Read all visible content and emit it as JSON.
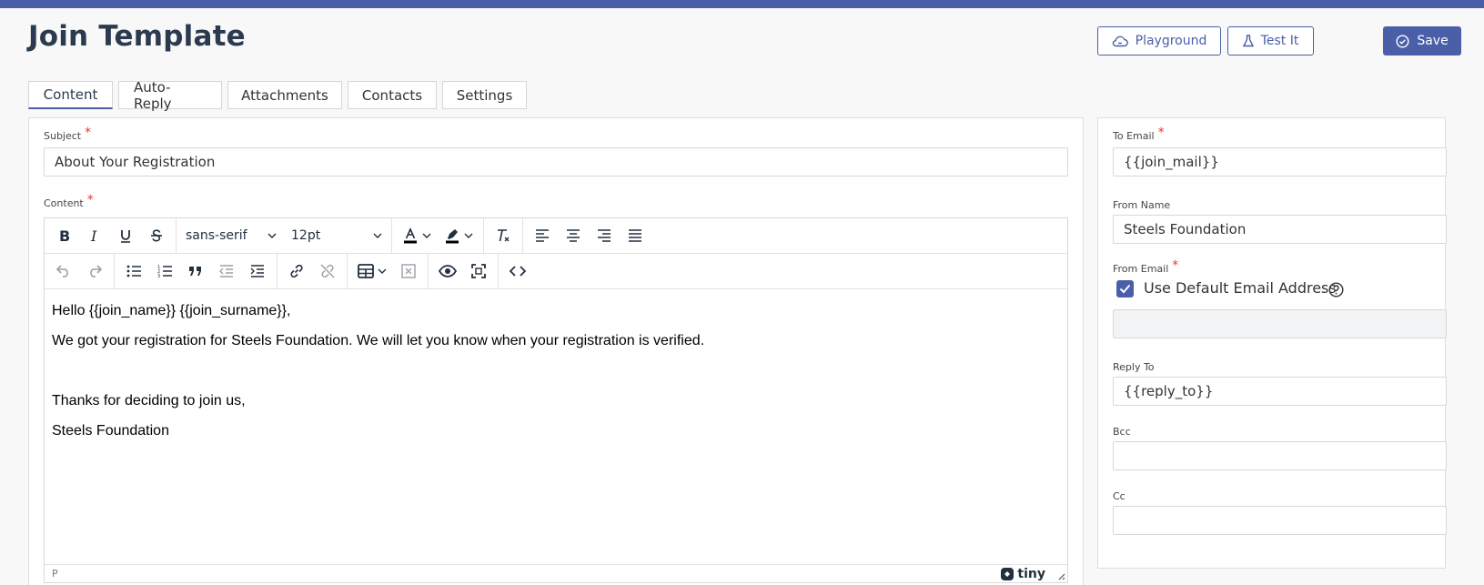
{
  "page": {
    "title": "Join Template"
  },
  "header": {
    "playground_label": "Playground",
    "testit_label": "Test It",
    "save_label": "Save"
  },
  "tabs": [
    {
      "label": "Content",
      "active": true
    },
    {
      "label": "Auto-Reply",
      "active": false
    },
    {
      "label": "Attachments",
      "active": false
    },
    {
      "label": "Contacts",
      "active": false
    },
    {
      "label": "Settings",
      "active": false
    }
  ],
  "form": {
    "subject_label": "Subject",
    "subject_value": "About Your Registration",
    "content_label": "Content",
    "required_mark": "*"
  },
  "editor": {
    "font_family": "sans-serif",
    "font_size": "12pt",
    "paragraphs": [
      "Hello {{join_name}} {{join_surname}},",
      "We got your registration for Steels Foundation. We will let you know when your registration is verified.",
      "",
      "Thanks for deciding to join us,",
      "Steels Foundation"
    ],
    "status_path": "P",
    "brand": "tiny"
  },
  "sidebar": {
    "to_email_label": "To Email",
    "to_email_value": "{{join_mail}}",
    "from_name_label": "From Name",
    "from_name_value": "Steels Foundation",
    "from_email_label": "From Email",
    "use_default_label": "Use Default Email Address",
    "use_default_checked": true,
    "from_email_value": "",
    "reply_to_label": "Reply To",
    "reply_to_value": "{{reply_to}}",
    "bcc_label": "Bcc",
    "bcc_value": "",
    "cc_label": "Cc",
    "cc_value": ""
  },
  "colors": {
    "accent": "#4a5fa8",
    "required": "#e03c3c",
    "title": "#2b3a4f"
  }
}
